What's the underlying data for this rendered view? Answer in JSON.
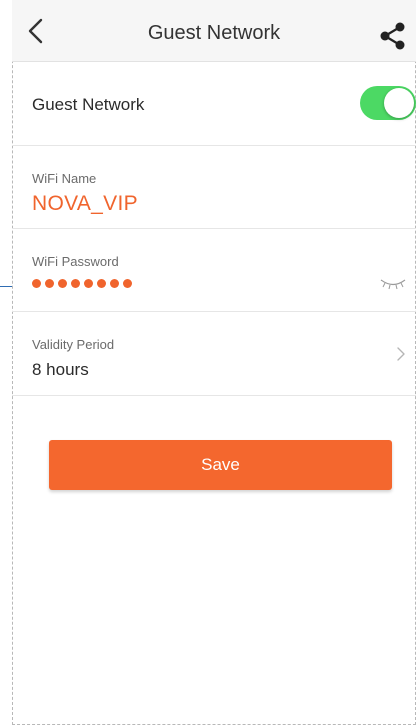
{
  "header": {
    "title": "Guest Network",
    "back_icon": "chevron-left-icon",
    "share_icon": "share-icon"
  },
  "guest_toggle": {
    "label": "Guest Network",
    "enabled": true,
    "on_color": "#4cd964"
  },
  "wifi_name": {
    "label": "WiFi Name",
    "value": "NOVA_VIP"
  },
  "wifi_password": {
    "label": "WiFi Password",
    "masked_length": 8,
    "visibility_icon": "eye-closed-icon"
  },
  "validity_period": {
    "label": "Validity Period",
    "value": "8 hours",
    "chevron_icon": "chevron-right-icon"
  },
  "actions": {
    "save_label": "Save"
  },
  "colors": {
    "accent": "#f0642d",
    "button": "#f4672e",
    "header_bg": "#f6f6f6",
    "divider": "#e6e6e6"
  }
}
